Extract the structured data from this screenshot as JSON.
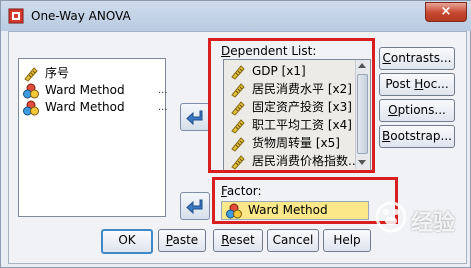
{
  "window": {
    "title": "One-Way ANOVA",
    "close_label": "×"
  },
  "source_list": {
    "items": [
      {
        "label": "序号",
        "icon": "ruler-icon"
      },
      {
        "label": "Ward Method",
        "icon": "nominal-icon",
        "ellipsis": "..."
      },
      {
        "label": "Ward Method",
        "icon": "nominal-icon",
        "ellipsis": "..."
      }
    ]
  },
  "dependent": {
    "label_mnemonic": "D",
    "label_rest": "ependent List:",
    "items": [
      "GDP [x1]",
      "居民消费水平 [x2]",
      "固定资产投资 [x3]",
      "职工平均工资 [x4]",
      "货物周转量 [x5]",
      "居民消费价格指数..."
    ]
  },
  "factor": {
    "label_mnemonic": "F",
    "label_rest": "actor:",
    "value": "Ward Method"
  },
  "side_buttons": [
    {
      "mnemonic": "C",
      "rest": "ontrasts..."
    },
    {
      "pre": "Post ",
      "mnemonic": "H",
      "rest": "oc..."
    },
    {
      "mnemonic": "O",
      "rest": "ptions..."
    },
    {
      "mnemonic": "B",
      "rest": "ootstrap..."
    }
  ],
  "bottom_buttons": {
    "ok": "OK",
    "paste_mnemonic": "P",
    "paste_rest": "aste",
    "reset_mnemonic": "R",
    "reset_rest": "eset",
    "cancel": "Cancel",
    "help": "Help"
  },
  "watermark": {
    "text": "经验"
  },
  "colors": {
    "highlight_box": "#d81e1e",
    "factor_fill": "#fbe989"
  }
}
